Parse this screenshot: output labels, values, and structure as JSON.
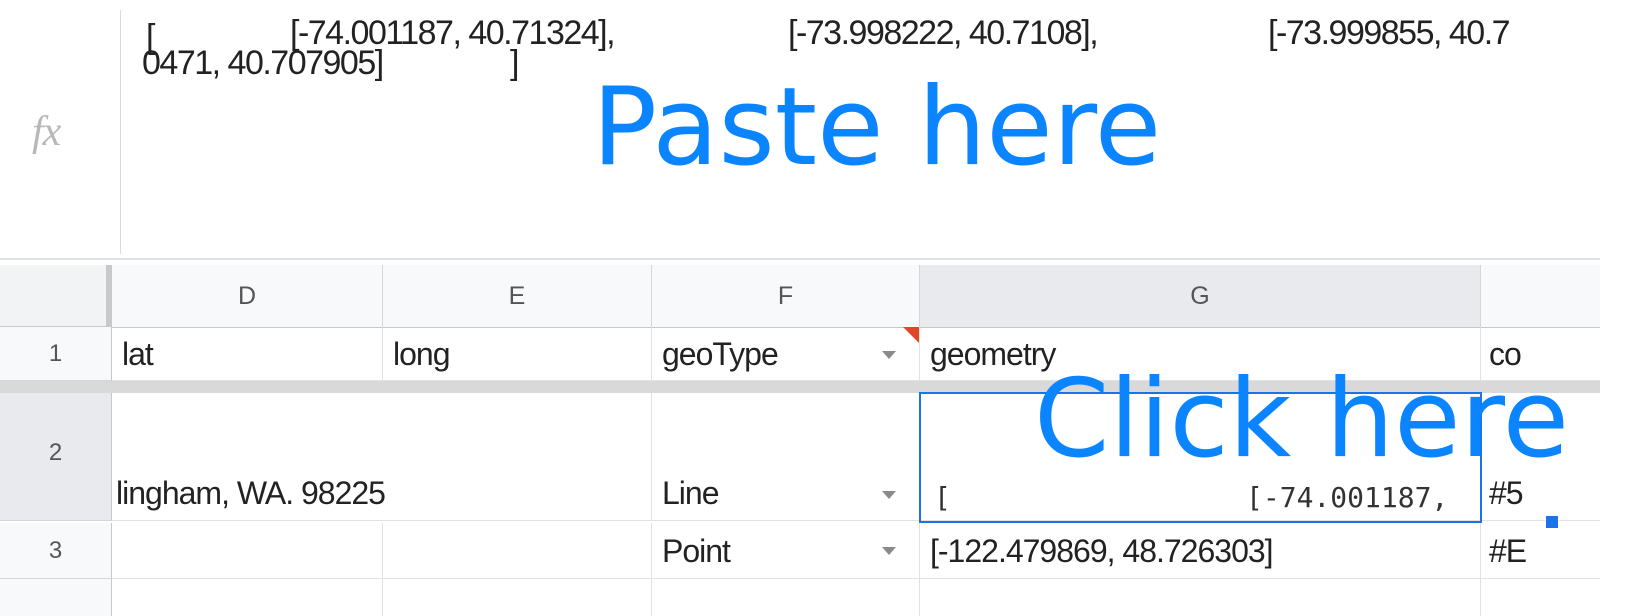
{
  "formula_bar": {
    "fx_label": "fx",
    "line1_a": "[",
    "line1_b": "[-74.001187, 40.71324],",
    "line1_c": "[-73.998222, 40.7108],",
    "line1_d": "[-73.999855, 40.7",
    "line2_a": "0471, 40.707905]",
    "line2_b": "]"
  },
  "overlays": {
    "paste_here": "Paste here",
    "click_here": "Click here"
  },
  "columns": {
    "d": "D",
    "e": "E",
    "f": "F",
    "g": "G"
  },
  "rows": {
    "r1": "1",
    "r2": "2",
    "r3": "3"
  },
  "cells": {
    "d1": "lat",
    "e1": "long",
    "f1": "geoType",
    "g1": "geometry",
    "h1": "co",
    "d2": "lingham, WA. 98225",
    "f2": "Line",
    "g2_a": "[",
    "g2_b": "[-74.001187,",
    "h2": "#5",
    "f3": "Point",
    "g3": "[-122.479869, 48.726303]",
    "h3": "#E"
  },
  "colors": {
    "overlay_text": "#0a84ff",
    "selection": "#1a73e8",
    "note_marker": "#e2452a"
  }
}
